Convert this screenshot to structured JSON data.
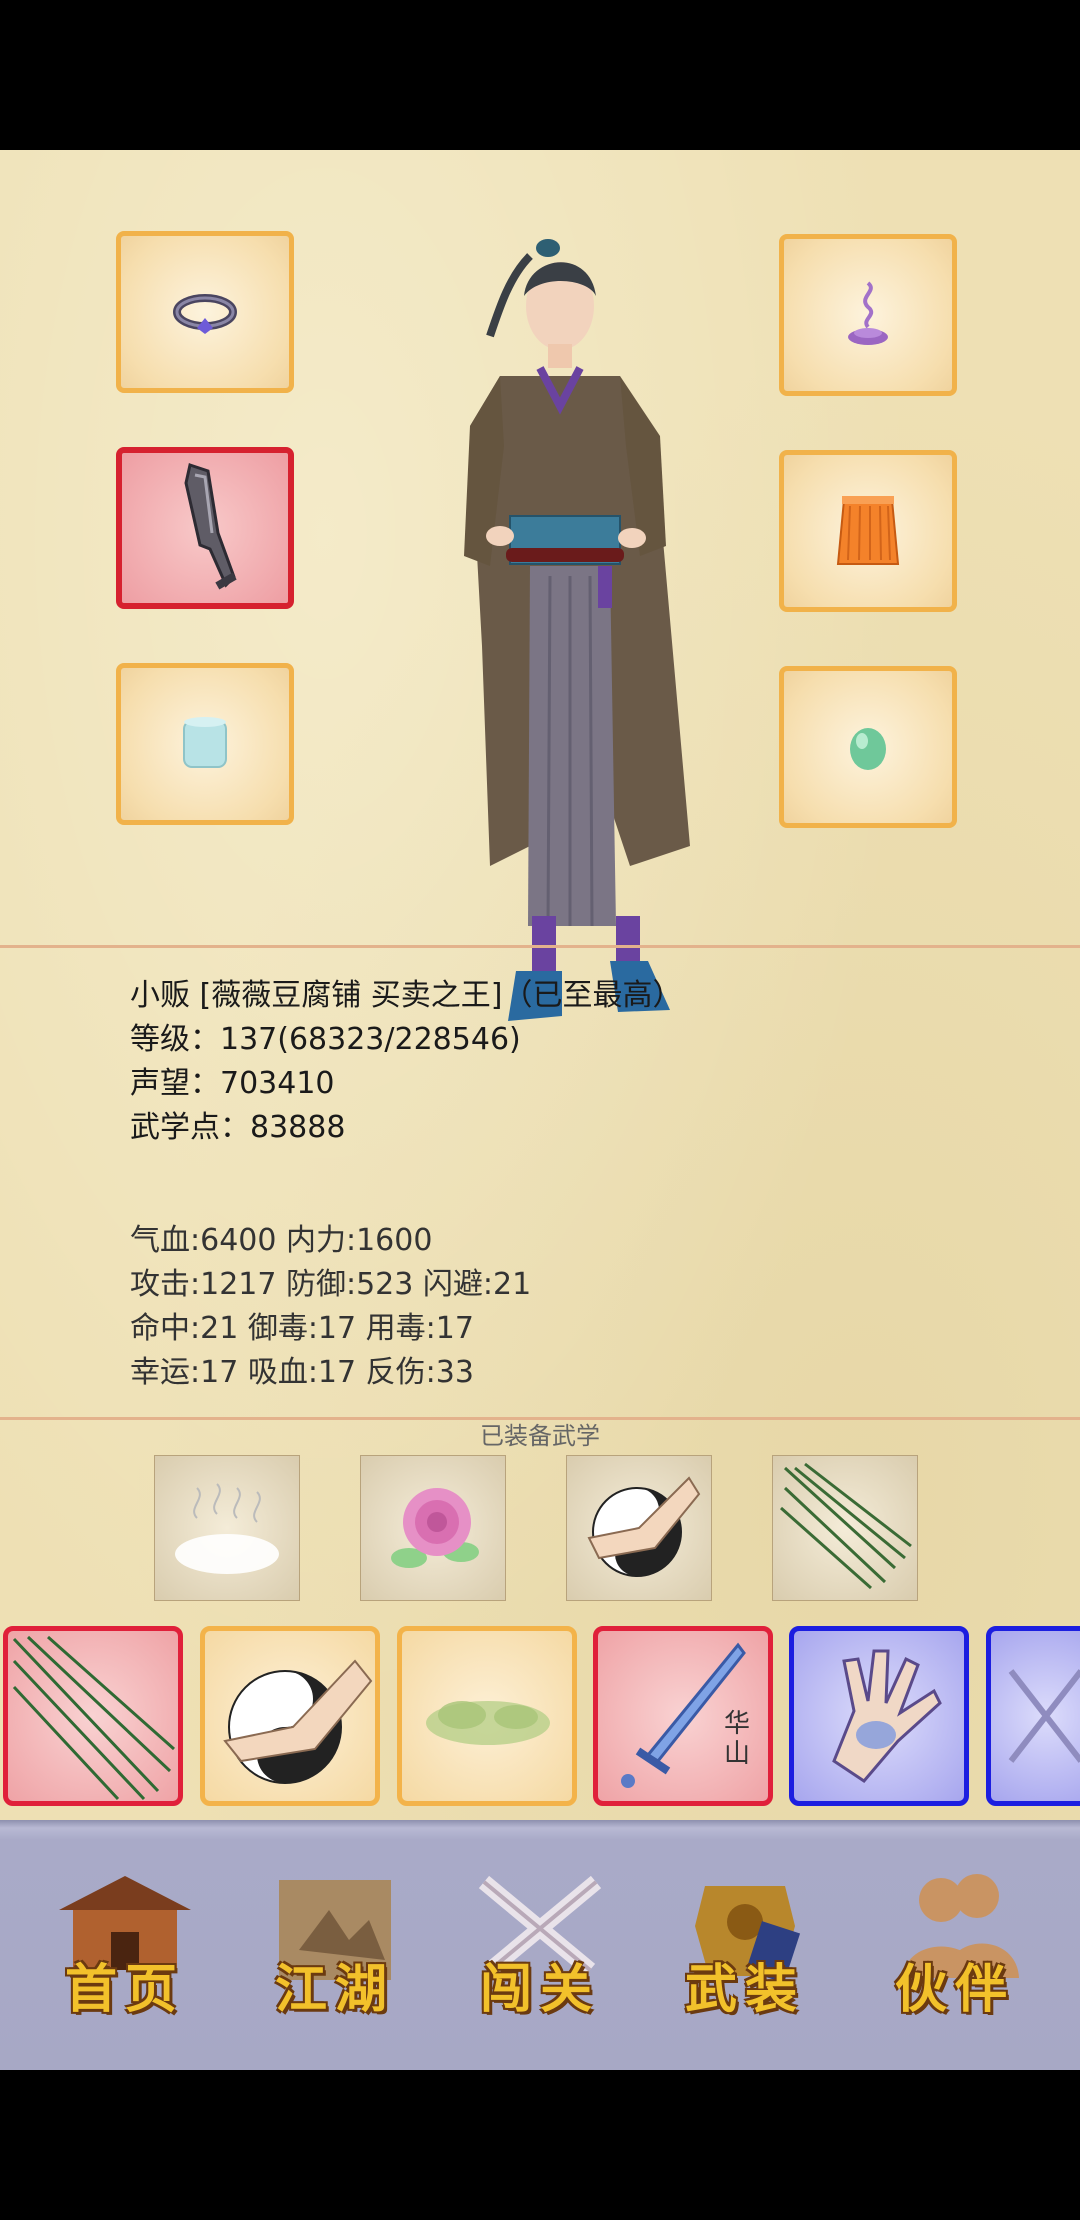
{
  "profile": {
    "title_line": "小贩 [薇薇豆腐铺 买卖之王]（已至最高）",
    "level": "等级：137(68323/228546)",
    "fame": "声望：703410",
    "martial_points": "武学点：83888"
  },
  "stats": {
    "line1": "气血:6400  内力:1600",
    "line2": "攻击:1217  防御:523  闪避:21",
    "line3": "命中:21  御毒:17  用毒:17",
    "line4": "幸运:17  吸血:17  反伤:33"
  },
  "equipped_martial": {
    "heading": "已装备武学"
  },
  "martial_list": {
    "huashan_label": "华山"
  },
  "equipment": {
    "left": [
      "ring",
      "sword",
      "bracelet"
    ],
    "right": [
      "incense",
      "skirt-armor",
      "jade"
    ]
  },
  "nav": {
    "home": "首页",
    "jianghu": "江湖",
    "challenge": "闯关",
    "arms": "武装",
    "partner": "伙伴"
  },
  "colors": {
    "parchment": "#eee0b4",
    "slot_border": "#f1b24a",
    "slot_selected_border": "#d6212f",
    "martial_blue_border": "#1c1ee0",
    "nav_bar": "#a9aac8",
    "nav_text": "#f2c12b"
  }
}
